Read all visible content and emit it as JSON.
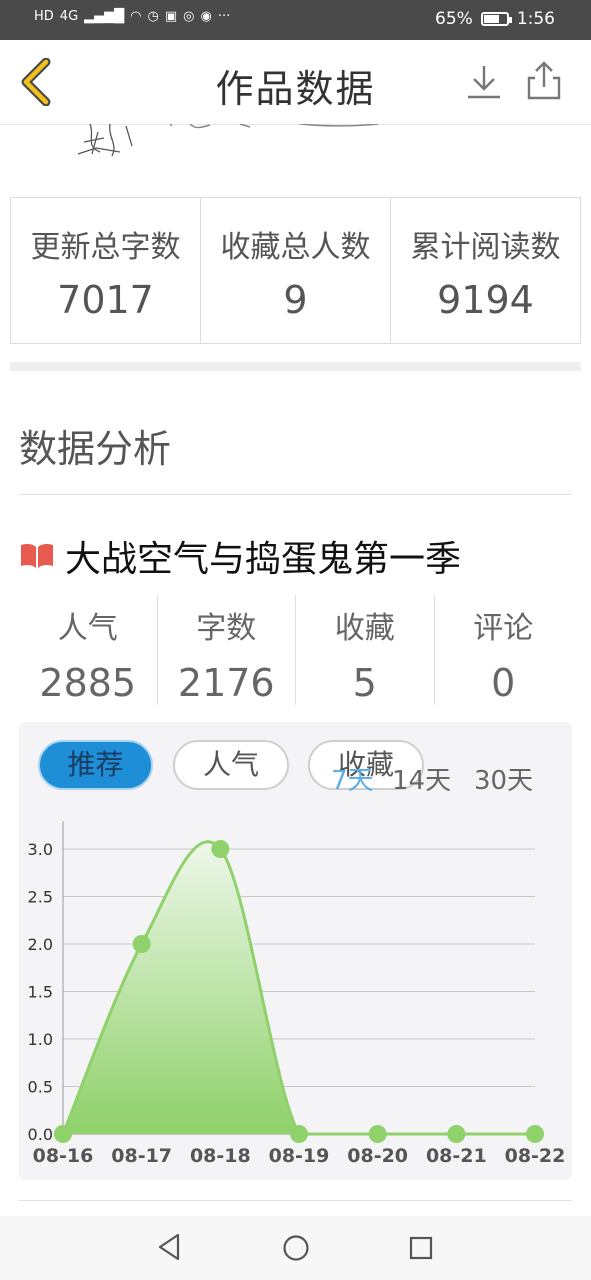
{
  "status_bar": {
    "network": "4G",
    "battery": "65%",
    "time": "1:56",
    "icons": [
      "hd-icon",
      "signal-icon",
      "wifi-icon",
      "sync-icon",
      "app-icon",
      "wechat-icon",
      "weibo-icon",
      "more-icon"
    ]
  },
  "header": {
    "title": "作品数据",
    "back_icon": "chevron-left-icon",
    "download_icon": "download-icon",
    "share_icon": "share-icon"
  },
  "summary": [
    {
      "label": "更新总字数",
      "value": "7017"
    },
    {
      "label": "收藏总人数",
      "value": "9"
    },
    {
      "label": "累计阅读数",
      "value": "9194"
    }
  ],
  "analysis": {
    "section_title": "数据分析",
    "work_title": "大战空气与捣蛋鬼第一季",
    "book_icon": "book-icon",
    "stats": [
      {
        "label": "人气",
        "value": "2885"
      },
      {
        "label": "字数",
        "value": "2176"
      },
      {
        "label": "收藏",
        "value": "5"
      },
      {
        "label": "评论",
        "value": "0"
      }
    ]
  },
  "chart_controls": {
    "metric_tabs": [
      "推荐",
      "人气",
      "收藏"
    ],
    "active_metric": "推荐",
    "ranges": [
      "7天",
      "14天",
      "30天"
    ],
    "active_range": "7天",
    "accent": "#1e8ed6"
  },
  "chart_data": {
    "type": "area",
    "x": [
      "08-16",
      "08-17",
      "08-18",
      "08-19",
      "08-20",
      "08-21",
      "08-22"
    ],
    "series": [
      {
        "values": [
          0,
          2,
          3,
          0,
          0,
          0,
          0
        ]
      }
    ],
    "ylim": [
      0,
      3
    ],
    "yticks": [
      "0.0",
      "0.5",
      "1.0",
      "1.5",
      "2.0",
      "2.5",
      "3.0"
    ],
    "grid": true,
    "color": "#8fd16a"
  },
  "navbar": {
    "icons": [
      "nav-back-icon",
      "nav-home-icon",
      "nav-recent-icon"
    ]
  }
}
